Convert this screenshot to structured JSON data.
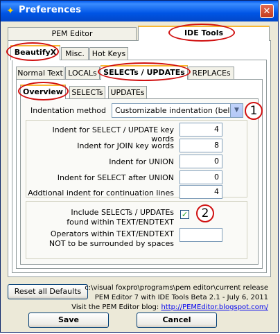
{
  "window": {
    "title": "Preferences"
  },
  "top_tabs": [
    "PEM Editor",
    "IDE Tools"
  ],
  "second_tabs": [
    "BeautifyX",
    "Misc.",
    "Hot Keys"
  ],
  "third_tabs": [
    "Normal Text",
    "LOCALs",
    "SELECTs / UPDATEs",
    "REPLACEs"
  ],
  "fourth_tabs": [
    "Overview",
    "SELECTs",
    "UPDATEs"
  ],
  "indentation": {
    "label": "Indentation method",
    "value": "Customizable indentation (belo",
    "callout": "1"
  },
  "fields": [
    {
      "label": "Indent for SELECT / UPDATE key words",
      "value": "4"
    },
    {
      "label": "Indent for JOIN key words",
      "value": "8"
    },
    {
      "label": "Indent for UNION",
      "value": "0"
    },
    {
      "label": "Indent for SELECT after UNION",
      "value": "0"
    },
    {
      "label": "Addtional indent for continuation lines",
      "value": "4"
    }
  ],
  "textendtext": {
    "include_label_1": "Include SELECTs / UPDATEs",
    "include_label_2": "found within TEXT/ENDTEXT",
    "include_checked": true,
    "callout": "2",
    "operators_label_1": "Operators within TEXT/ENDTEXT",
    "operators_label_2": "NOT to be surrounded by spaces",
    "operators_value": ""
  },
  "footer": {
    "reset_label": "Reset all Defaults",
    "path": "c:\\visual foxpro\\programs\\pem editor\\current release",
    "version": "PEM Editor 7 with IDE Tools Beta 2.1 - July 6, 2011",
    "blog_prefix": "Visit the PEM Editor blog:",
    "blog_link": "http://PEMEditor.blogspot.com/",
    "save_label": "Save",
    "cancel_label": "Cancel"
  },
  "colors": {
    "annotation": "#d01010",
    "tab_highlight": "#f8b732",
    "titlebar": "#0058ee"
  }
}
